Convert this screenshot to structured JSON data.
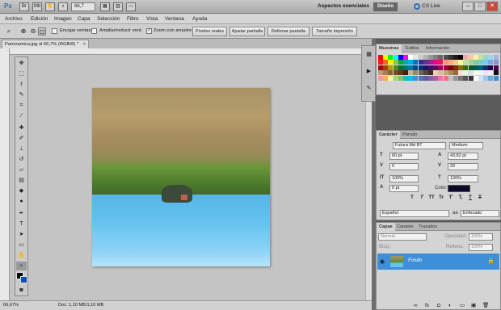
{
  "app": {
    "logo": "Ps",
    "zoom": "66,7",
    "workspace": "Aspectos esenciales",
    "workspace_button": "Diseño",
    "cslive": "CS Live",
    "win_min": "–",
    "win_max": "□",
    "win_close": "✕"
  },
  "menu": [
    "Archivo",
    "Edición",
    "Imagen",
    "Capa",
    "Selección",
    "Filtro",
    "Vista",
    "Ventana",
    "Ayuda"
  ],
  "options": {
    "resize_windows": "Encajar ventana",
    "zoom_all": "Ampliar/reducir vent.",
    "scrubby_zoom": "Zoom con arrastre",
    "btn_actual": "Píxeles reales",
    "btn_fit": "Ajustar pantalla",
    "btn_fill": "Rellenar pantalla",
    "btn_print": "Tamaño impresión"
  },
  "document": {
    "tab": "Panoramica.jpg al 66,7% (RGB/8) *",
    "close": "×",
    "zoom": "66,67%",
    "doc_info": "Doc: 1,10 MB/1,10 MB"
  },
  "swatches_panel": {
    "tabs": [
      "Muestras",
      "Estilos",
      "Información"
    ]
  },
  "character_panel": {
    "tabs": [
      "Carácter",
      "Párrafo"
    ],
    "font": "Futura Md BT",
    "style": "Medium",
    "size": "60 pt",
    "leading": "43,82 pt",
    "kerning": "0",
    "tracking": "20",
    "vscale": "100%",
    "hscale": "100%",
    "baseline": "0 pt",
    "color_label": "Color:",
    "language": "Español",
    "antialias": "Enfocado",
    "aa_label": "aa",
    "format_buttons": [
      "T",
      "T",
      "TT",
      "Tr",
      "T'",
      "T,",
      "T",
      "T"
    ]
  },
  "layers_panel": {
    "tabs": [
      "Capas",
      "Canales",
      "Trazados"
    ],
    "blend": "Normal",
    "opacity_label": "Opacidad:",
    "opacity": "100%",
    "lock_label": "Bloq.:",
    "fill_label": "Relleno:",
    "fill": "100%",
    "layer_name": "Fondo"
  },
  "colors": {
    "accent": "#3e8fd9",
    "foreground": "#000000",
    "background": "#0a4fb4",
    "text_color": "#0a0a2a"
  }
}
